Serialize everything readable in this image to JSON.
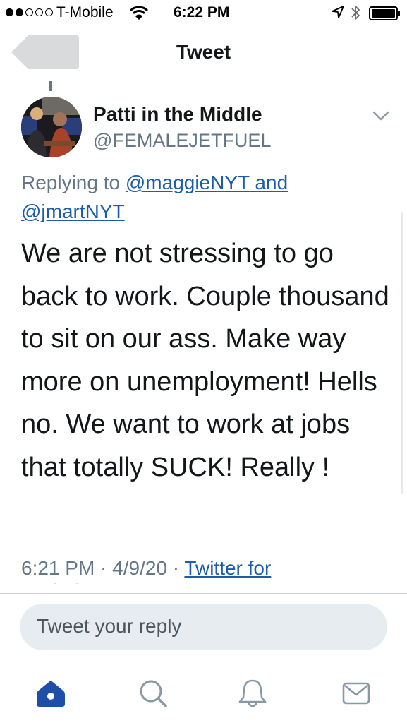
{
  "status_bar": {
    "carrier": "T-Mobile",
    "time": "6:22 PM",
    "signal_bars_filled": 2,
    "signal_bars_total": 5
  },
  "nav": {
    "title": "Tweet",
    "back_icon": "back-arrow-icon"
  },
  "tweet": {
    "author_name": "Patti in the Middle",
    "author_handle": "@FEMALEJETFUEL",
    "replying_prefix": "Replying to ",
    "reply_user_1": "@maggieNYT",
    "reply_joiner": " and",
    "reply_user_2": "@jmartNYT",
    "text": "We are not stressing to go back to work. Couple thousand to sit on our ass. Make way more on unemployment! Hells no. We want to work at jobs that totally SUCK! Really !",
    "time": "6:21 PM",
    "separator_1": " · ",
    "date": "4/9/20",
    "separator_2": " · ",
    "source": "Twitter for",
    "source_cont": "iPhone"
  },
  "reply": {
    "placeholder": "Tweet your reply"
  },
  "tabs": [
    {
      "name": "home",
      "icon": "home-icon",
      "active": true
    },
    {
      "name": "search",
      "icon": "search-icon",
      "active": false
    },
    {
      "name": "notifications",
      "icon": "bell-icon",
      "active": false
    },
    {
      "name": "messages",
      "icon": "envelope-icon",
      "active": false
    }
  ],
  "colors": {
    "accent": "#1da1f2",
    "link": "#1b5dab",
    "active_tab": "#1d4ea8",
    "inactive_tab": "#8899a6",
    "secondary_text": "#657786",
    "reply_box": "#e6ecf0"
  }
}
